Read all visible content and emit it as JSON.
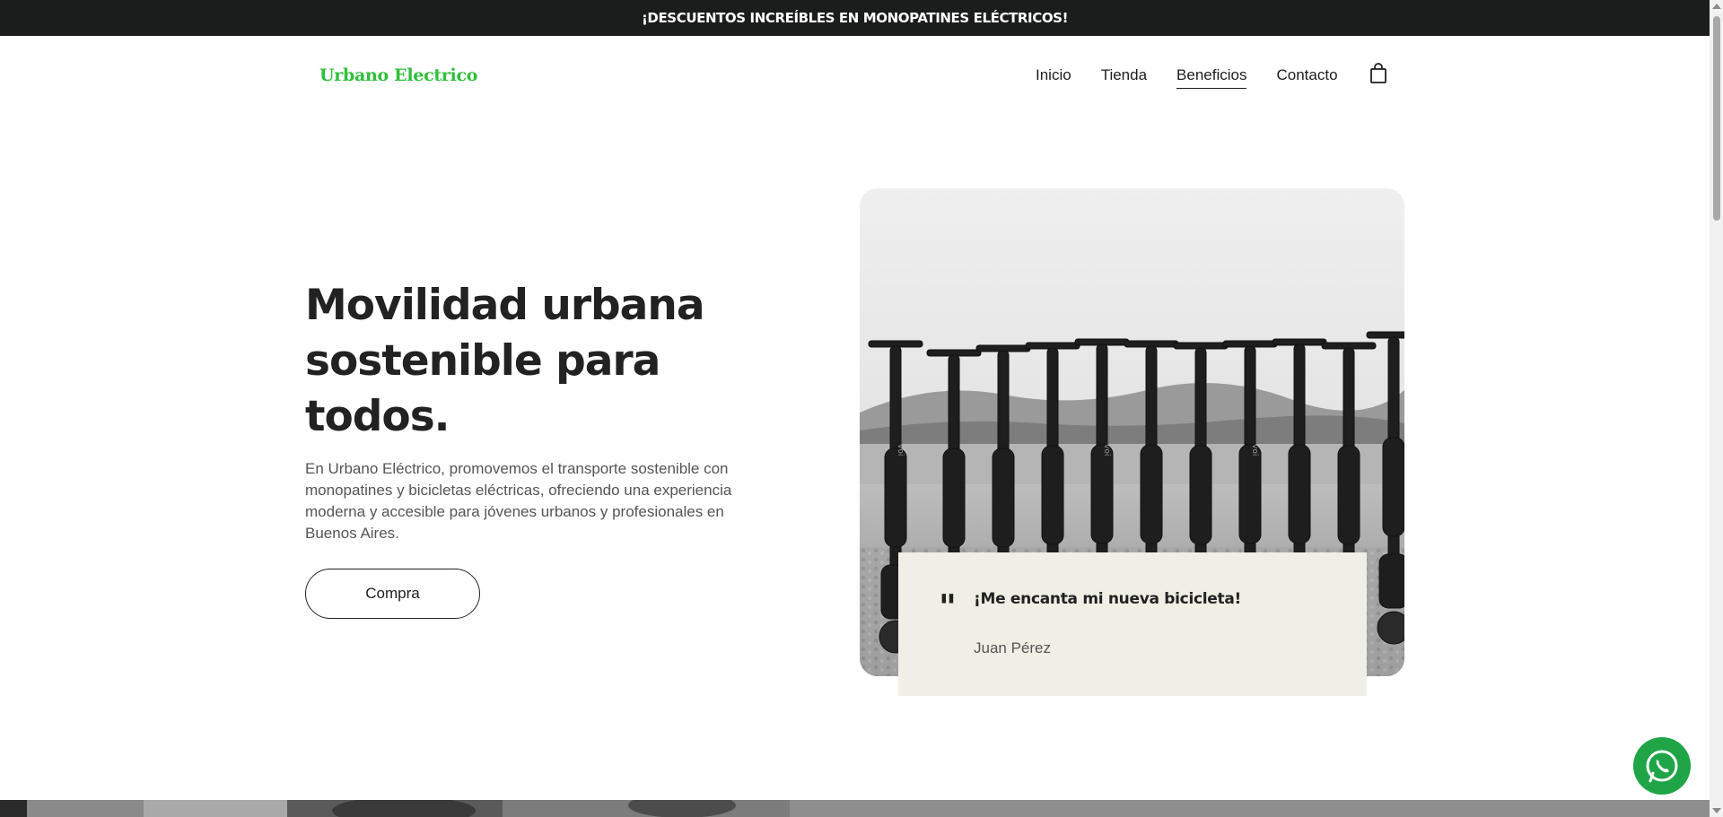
{
  "announcement": "¡DESCUENTOS INCREÍBLES EN MONOPATINES ELÉCTRICOS!",
  "brand": {
    "logo": "Urbano Electrico",
    "accent": "#2fbf3a"
  },
  "nav": {
    "items": [
      {
        "label": "Inicio"
      },
      {
        "label": "Tienda"
      },
      {
        "label": "Beneficios"
      },
      {
        "label": "Contacto"
      }
    ],
    "active": "Beneficios",
    "cart_icon": "shopping-bag-icon"
  },
  "hero": {
    "title_line1": "Movilidad urbana",
    "title_line2": "sostenible para todos.",
    "description": "En Urbano Eléctrico, promovemos el transporte sostenible con monopatines y bicicletas eléctricas, ofreciendo una experiencia moderna y accesible para jóvenes urbanos y profesionales en Buenos Aires.",
    "cta_label": "Compra"
  },
  "testimonial": {
    "quote": "¡Me encanta mi nueva bicicleta!",
    "author": "Juan Pérez"
  },
  "floating": {
    "whatsapp_icon": "whatsapp-icon",
    "color": "#1fa447"
  },
  "colors": {
    "topbar": "#1b1d1c",
    "testimonial_bg": "#efefe5"
  }
}
